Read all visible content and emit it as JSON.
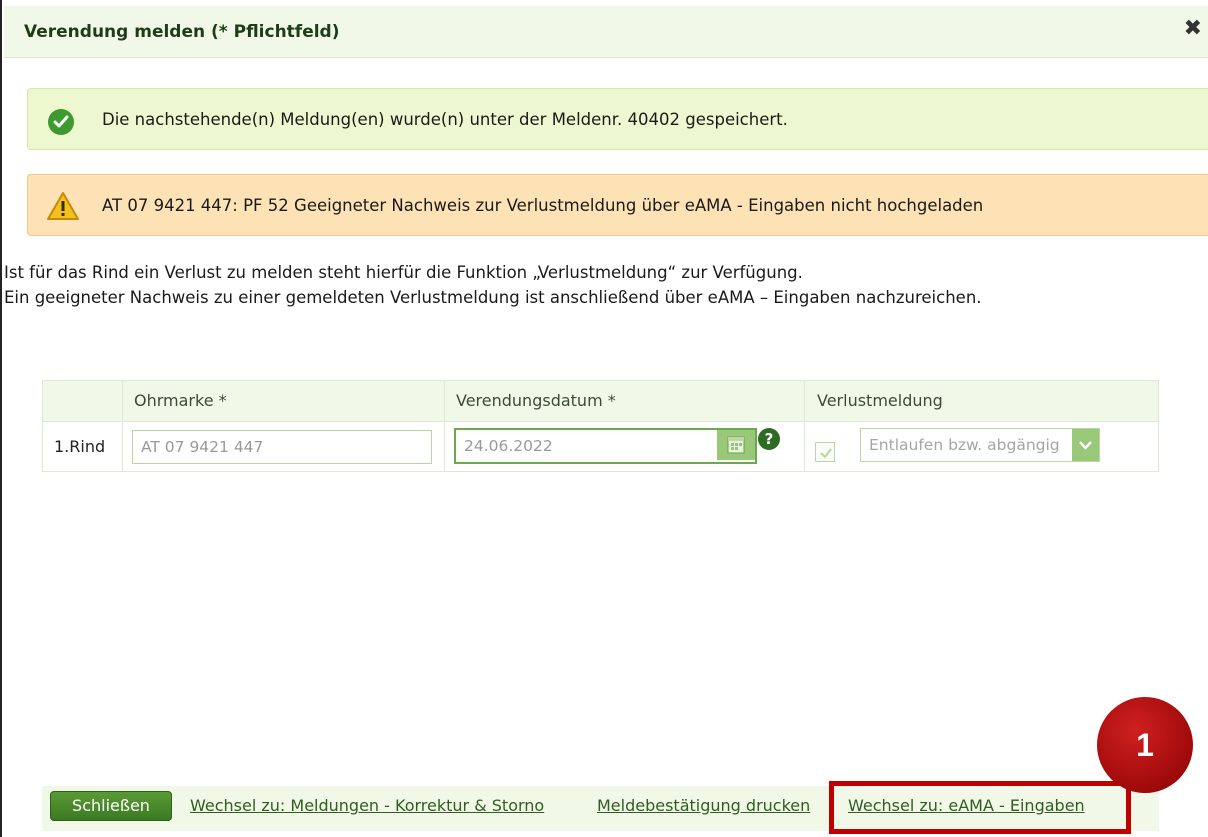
{
  "dialog": {
    "title": "Verendung melden (* Pflichtfeld)",
    "close_glyph": "✖"
  },
  "messages": {
    "success": "Die nachstehende(n) Meldung(en) wurde(n) unter der Meldenr. 40402 gespeichert.",
    "warning": "AT 07 9421 447: PF 52 Geeigneter Nachweis zur Verlustmeldung über eAMA - Eingaben nicht hochgeladen"
  },
  "info": {
    "line1": "Ist für das Rind ein Verlust zu melden steht hierfür die Funktion „Verlustmeldung“ zur Verfügung.",
    "line2": "Ein geeigneter Nachweis zu einer gemeldeten Verlustmeldung ist anschließend über eAMA – Eingaben nachzureichen."
  },
  "table": {
    "headers": {
      "ohrmarke": "Ohrmarke *",
      "datum": "Verendungsdatum *",
      "verlust": "Verlustmeldung"
    },
    "rows": [
      {
        "label": "1.Rind",
        "ohrmarke": "AT 07 9421 447",
        "datum": "24.06.2022",
        "verlust_checked": true,
        "verlust_reason": "Entlaufen bzw. abgängig"
      }
    ]
  },
  "footer": {
    "close_button": "Schließen",
    "link_korrektur": "Wechsel zu: Meldungen - Korrektur & Storno",
    "link_druck": "Meldebestätigung drucken",
    "link_eama": "Wechsel zu: eAMA - Eingaben"
  },
  "annotation": {
    "badge_number": "1"
  },
  "colors": {
    "accent_green": "#3b7a22",
    "success_bg": "#eef8d0",
    "warning_bg": "#fde2b6",
    "highlight_red": "#c00000"
  },
  "icons": {
    "success": "check-circle-icon",
    "warning": "warning-triangle-icon",
    "calendar": "calendar-icon",
    "help": "help-icon",
    "dropdown": "chevron-down-icon",
    "close": "close-icon"
  }
}
